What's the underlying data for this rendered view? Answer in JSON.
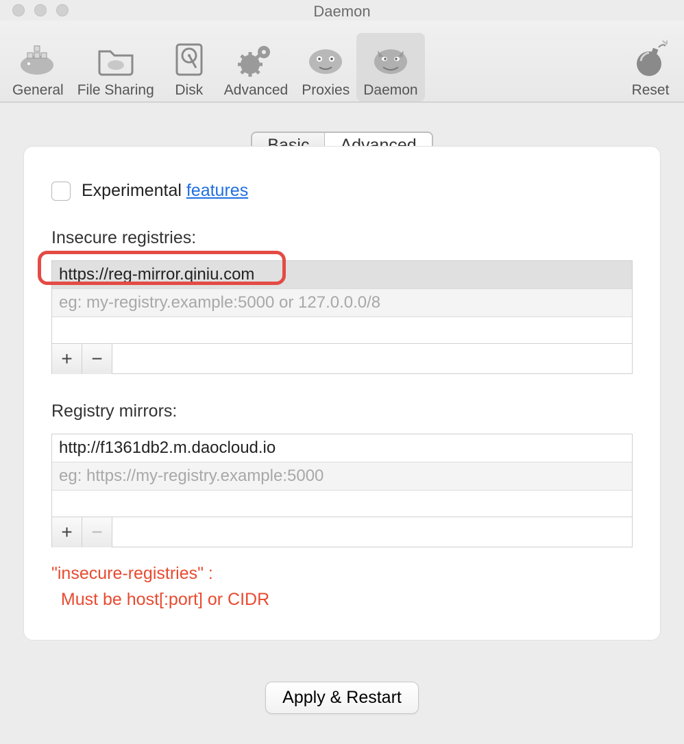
{
  "window": {
    "title": "Daemon"
  },
  "toolbar": {
    "general": "General",
    "filesharing": "File Sharing",
    "disk": "Disk",
    "advanced": "Advanced",
    "proxies": "Proxies",
    "daemon": "Daemon",
    "reset": "Reset"
  },
  "subtabs": {
    "basic": "Basic",
    "advanced": "Advanced"
  },
  "experimental": {
    "label_prefix": "Experimental ",
    "link_text": "features"
  },
  "insecure": {
    "label": "Insecure registries:",
    "value": "https://reg-mirror.qiniu.com",
    "placeholder": "eg: my-registry.example:5000 or 127.0.0.0/8",
    "plus": "+",
    "minus": "−"
  },
  "mirrors": {
    "label": "Registry mirrors:",
    "value": "http://f1361db2.m.daocloud.io",
    "placeholder": "eg: https://my-registry.example:5000",
    "plus": "+",
    "minus": "−"
  },
  "error": {
    "line1": "\"insecure-registries\" :",
    "line2": "  Must be host[:port] or CIDR"
  },
  "apply": {
    "label": "Apply & Restart"
  }
}
